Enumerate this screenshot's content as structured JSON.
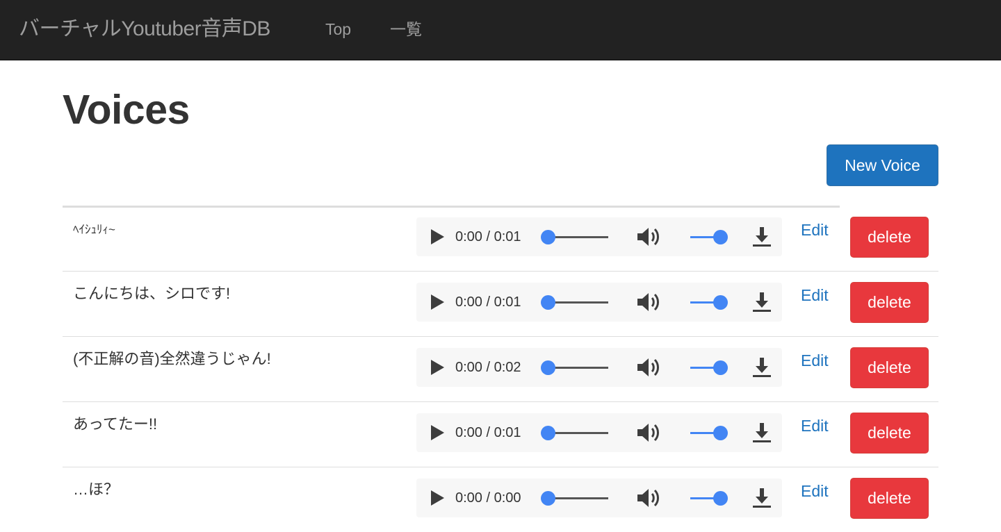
{
  "navbar": {
    "brand": "バーチャルYoutuber音声DB",
    "links": [
      "Top",
      "一覧"
    ]
  },
  "page": {
    "title": "Voices",
    "new_button": "New Voice"
  },
  "voices": [
    {
      "name": "ﾍｲｼｭﾘｨ~",
      "time": "0:00 / 0:01",
      "edit": "Edit",
      "delete": "delete"
    },
    {
      "name": "こんにちは、シロです!",
      "time": "0:00 / 0:01",
      "edit": "Edit",
      "delete": "delete"
    },
    {
      "name": "(不正解の音)全然違うじゃん!",
      "time": "0:00 / 0:02",
      "edit": "Edit",
      "delete": "delete"
    },
    {
      "name": "あってたー!!",
      "time": "0:00 / 0:01",
      "edit": "Edit",
      "delete": "delete"
    },
    {
      "name": "…ほ？",
      "time": "0:00 / 0:00",
      "edit": "Edit",
      "delete": "delete"
    }
  ],
  "icons": {
    "play": "play-icon",
    "volume": "volume-icon",
    "download": "download-icon"
  },
  "colors": {
    "navbar_bg": "#222222",
    "primary": "#1e73be",
    "danger": "#e8383d",
    "slider": "#4285f4"
  }
}
